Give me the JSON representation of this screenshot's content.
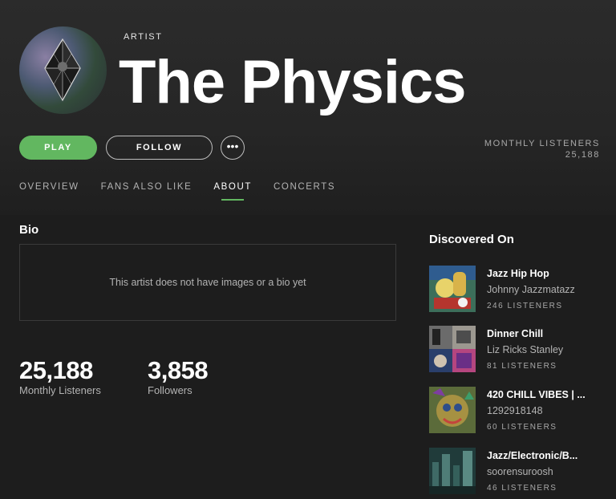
{
  "artist": {
    "type_label": "ARTIST",
    "name": "The Physics"
  },
  "actions": {
    "play_label": "PLAY",
    "follow_label": "FOLLOW",
    "more_label": "•••"
  },
  "monthly_listeners": {
    "label": "MONTHLY LISTENERS",
    "value": "25,188"
  },
  "tabs": [
    {
      "label": "OVERVIEW",
      "active": false
    },
    {
      "label": "FANS ALSO LIKE",
      "active": false
    },
    {
      "label": "ABOUT",
      "active": true
    },
    {
      "label": "CONCERTS",
      "active": false
    }
  ],
  "bio": {
    "title": "Bio",
    "empty_text": "This artist does not have images or a bio yet"
  },
  "stats": [
    {
      "value": "25,188",
      "caption": "Monthly Listeners"
    },
    {
      "value": "3,858",
      "caption": "Followers"
    }
  ],
  "discovered_on": {
    "title": "Discovered On",
    "items": [
      {
        "name": "Jazz Hip Hop",
        "owner": "Johnny Jazzmatazz",
        "listeners": "246 LISTENERS"
      },
      {
        "name": "Dinner Chill",
        "owner": "Liz Ricks Stanley",
        "listeners": "81 LISTENERS"
      },
      {
        "name": "420 CHILL VIBES | ...",
        "owner": "1292918148",
        "listeners": "60 LISTENERS"
      },
      {
        "name": "Jazz/Electronic/B...",
        "owner": "soorensuroosh",
        "listeners": "46 LISTENERS"
      }
    ]
  },
  "colors": {
    "accent_green": "#62b760",
    "background": "#1d1d1d"
  }
}
